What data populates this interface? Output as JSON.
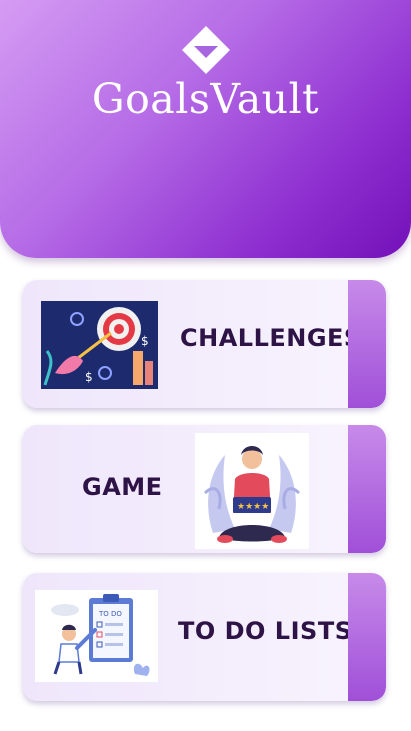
{
  "header": {
    "app_name": "GoalsVault",
    "logo_icon": "diamond-logo-icon",
    "gradient": [
      "#d59cf3",
      "#7310b8"
    ]
  },
  "cards": [
    {
      "label": "CHALLENGES",
      "illustration": "target-arrow-illustration"
    },
    {
      "label": "GAME",
      "illustration": "person-with-tablet-illustration"
    },
    {
      "label": "TO DO LISTS",
      "illustration": "todo-checklist-illustration"
    }
  ],
  "colors": {
    "accent": "#a050d8",
    "text": "#2d1346"
  }
}
